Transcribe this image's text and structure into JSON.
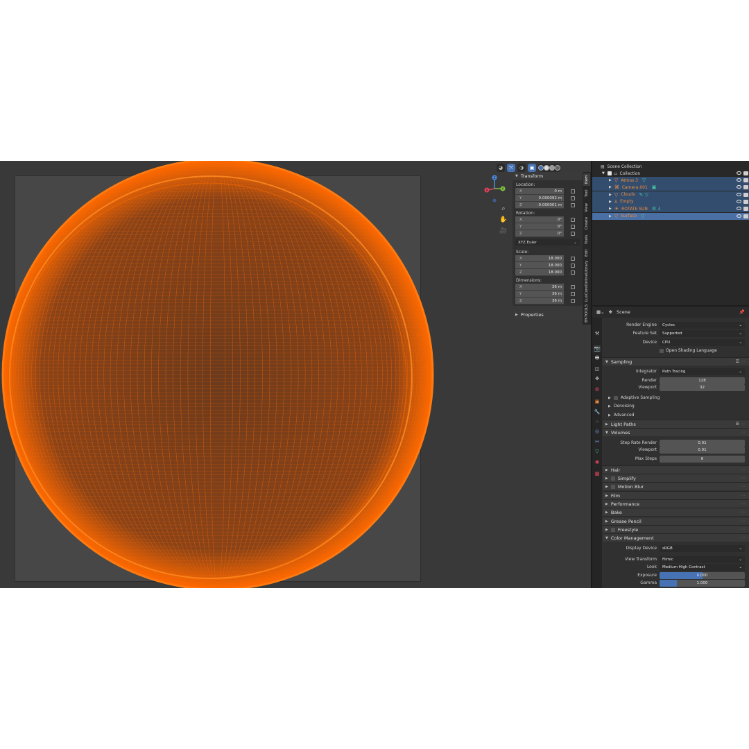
{
  "colors": {
    "accent": "#4772b3",
    "wire": "#ff6a00",
    "object": "#f08c3a",
    "extra": "#49c7a6"
  },
  "viewport": {
    "gizmo": {
      "x": "X",
      "y": "Y",
      "z": "Z"
    }
  },
  "npanel": {
    "tabs": [
      "Item",
      "Tool",
      "View",
      "Create",
      "Tools",
      "Edit",
      "LuxCoreOnlineLibrary",
      "BY-TOOLS"
    ],
    "transform_title": "Transform",
    "location_label": "Location:",
    "location": [
      {
        "axis": "X",
        "value": "0 m"
      },
      {
        "axis": "Y",
        "value": "0.000092 m"
      },
      {
        "axis": "Z",
        "value": "-0.000001 m"
      }
    ],
    "rotation_label": "Rotation:",
    "rotation": [
      {
        "axis": "X",
        "value": "0°"
      },
      {
        "axis": "Y",
        "value": "0°"
      },
      {
        "axis": "Z",
        "value": "0°"
      }
    ],
    "rotation_mode": "XYZ Euler",
    "scale_label": "Scale:",
    "scale": [
      {
        "axis": "X",
        "value": "18.000"
      },
      {
        "axis": "Y",
        "value": "18.000"
      },
      {
        "axis": "Z",
        "value": "18.000"
      }
    ],
    "dimensions_label": "Dimensions:",
    "dimensions": [
      {
        "axis": "X",
        "value": "36 m"
      },
      {
        "axis": "Y",
        "value": "36 m"
      },
      {
        "axis": "Z",
        "value": "36 m"
      }
    ],
    "properties_title": "Properties"
  },
  "outliner": {
    "scene_collection": "Scene Collection",
    "collection": "Collection",
    "items": [
      {
        "name": "Atmos 3",
        "icon": "mesh-icon",
        "extra": "▽"
      },
      {
        "name": "Camera.001",
        "icon": "camera-icon",
        "extra": "▣"
      },
      {
        "name": "Clouds",
        "icon": "mesh-icon",
        "extra": "✎ ▽"
      },
      {
        "name": "Empty",
        "icon": "empty-icon",
        "extra": ""
      },
      {
        "name": "ROTATE SUN",
        "icon": "light-icon",
        "extra": "⚙ ⅄"
      },
      {
        "name": "Surface",
        "icon": "mesh-icon",
        "extra": "▽"
      }
    ]
  },
  "properties": {
    "header": "Scene",
    "render_engine_label": "Render Engine",
    "render_engine": "Cycles",
    "feature_set_label": "Feature Set",
    "feature_set": "Supported",
    "device_label": "Device",
    "device": "CPU",
    "osl_label": "Open Shading Language",
    "sampling_title": "Sampling",
    "integrator_label": "Integrator",
    "integrator": "Path Tracing",
    "render_label": "Render",
    "render_samples": "128",
    "viewport_label": "Viewport",
    "viewport_samples": "32",
    "adaptive_label": "Adaptive Sampling",
    "denoising_label": "Denoising",
    "advanced_label": "Advanced",
    "light_paths_title": "Light Paths",
    "volumes_title": "Volumes",
    "step_rate_render_label": "Step Rate Render",
    "step_rate_render": "0.01",
    "step_rate_viewport_label": "Viewport",
    "step_rate_viewport": "0.01",
    "max_steps_label": "Max Steps",
    "max_steps": "6",
    "hair_title": "Hair",
    "simplify_title": "Simplify",
    "motion_blur_title": "Motion Blur",
    "film_title": "Film",
    "performance_title": "Performance",
    "bake_title": "Bake",
    "grease_pencil_title": "Grease Pencil",
    "freestyle_title": "Freestyle",
    "color_management_title": "Color Management",
    "display_device_label": "Display Device",
    "display_device": "sRGB",
    "view_transform_label": "View Transform",
    "view_transform": "Filmic",
    "look_label": "Look",
    "look": "Medium High Contrast",
    "exposure_label": "Exposure",
    "exposure": "0.000",
    "exposure_fill": 0.5,
    "gamma_label": "Gamma",
    "gamma": "1.000",
    "gamma_fill": 0.2
  }
}
